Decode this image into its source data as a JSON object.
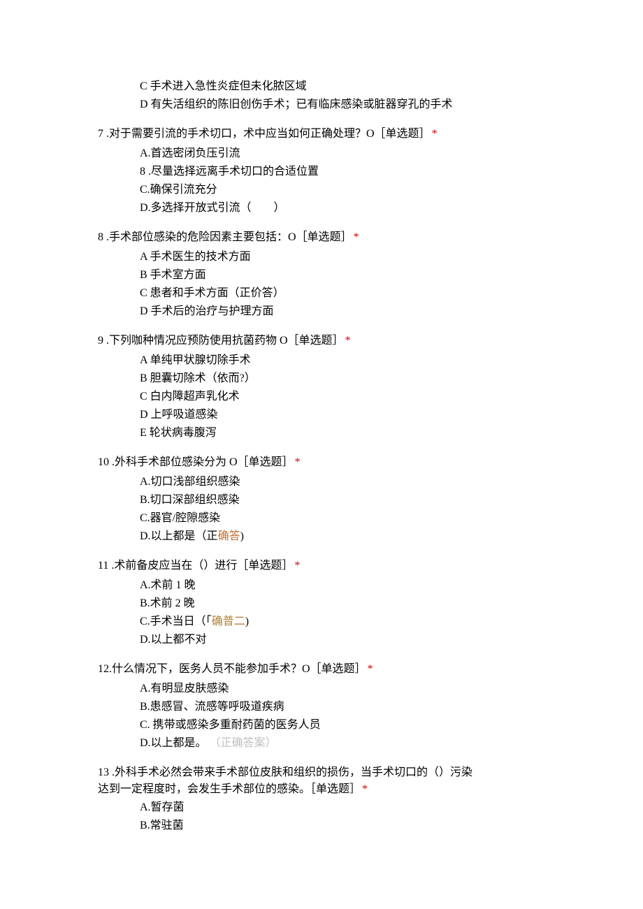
{
  "q6_continued": {
    "optC": "C 手术进入急性炎症但未化脓区域",
    "optD": "D 有失活组织的陈旧创伤手术；已有临床感染或脏器穿孔的手术"
  },
  "q7": {
    "stem": "7 .对于需要引流的手术切口，术中应当如何正确处理？O［单选题］",
    "optA": "A.首选密闭负压引流",
    "opt8": "8 .尽量选择远离手术切口的合适位置",
    "optC": "C.确保引流充分",
    "optD": "D.多选择开放式引流（　　）"
  },
  "q8": {
    "stem": "8 .手术部位感染的危险因素主要包括：O［单选题］",
    "optA": "A 手术医生的技术方面",
    "optB": "B 手术室方面",
    "optC": "C 患者和手术方面（正价答）",
    "optD": "D 手术后的治疗与护理方面"
  },
  "q9": {
    "stem": "9 .下列咖种情况应预防使用抗菌药物 O［单选题］",
    "optA": "A 单纯甲状腺切除手术",
    "optB": "B 胆囊切除术（依而?）",
    "optC": "C 白内障超声乳化术",
    "optD": "D 上呼吸道感染",
    "optE": "E 轮状病毒腹泻"
  },
  "q10": {
    "stem": "10 .外科手术部位感染分为 O［单选题］",
    "optA": "A.切口浅部组织感染",
    "optB": "B.切口深部组织感染",
    "optC": "C.器官/腔隙感染",
    "optD_prefix": "D.以上都是（正",
    "optD_answer": "确答",
    "optD_suffix": ")"
  },
  "q11": {
    "stem": "11 .术前备皮应当在（）进行［单选题］",
    "optA": "A.术前 1 晚",
    "optB": "B.术前 2 晚",
    "optC_prefix": "C.手术当日（「",
    "optC_answer": "确普二",
    "optC_suffix": ")",
    "optD": "D.以上都不对"
  },
  "q12": {
    "stem": "12.什么情况下，医务人员不能参加手术？O［单选题］",
    "optA": "A.有明显皮肤感染",
    "optB": "B.患感冒、流感等呼吸道疾病",
    "optC": "C. 携带或感染多重耐药菌的医务人员",
    "optD_prefix": "D.以上都是。",
    "optD_answer": "（正确答案）"
  },
  "q13": {
    "line1": "13 .外科手术必然会带来手术部位皮肤和组织的损伤，当手术切口的（）污染",
    "line2_prefix": "达到一定程度时，会发生手术部位的感染。［单选题］",
    "optA": "A.暂存菌",
    "optB": "B.常驻菌"
  },
  "asterisk": "*"
}
